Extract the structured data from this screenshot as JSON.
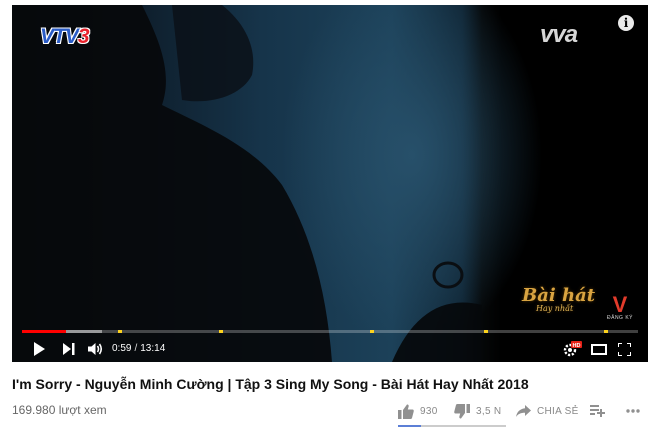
{
  "player": {
    "channel_logo": {
      "v": "VTV",
      "n": "3"
    },
    "brand_logo": "vva",
    "info_icon": "i",
    "show_logo": {
      "main": "Bài hát",
      "sub": "Hay nhất"
    },
    "subscribe_watermark": {
      "mark": "V",
      "label": "ĐĂNG KÝ"
    },
    "progress": {
      "played_fraction": 0.072,
      "buffered_fraction": 0.13,
      "ad_markers": [
        0.156,
        0.32,
        0.565,
        0.75,
        0.945
      ]
    },
    "time": {
      "current": "0:59",
      "separator": "/",
      "duration": "13:14"
    },
    "icons": [
      "play-icon",
      "next-icon",
      "volume-icon",
      "settings-hd-icon",
      "theater-icon",
      "fullscreen-icon"
    ],
    "hd_badge": "HD",
    "colors": {
      "progress": "#ff0000",
      "ad_marker": "#fcd21e",
      "hd_badge": "#e62117"
    }
  },
  "video": {
    "title": "I'm Sorry - Nguyễn Minh Cường | Tập 3 Sing My Song - Bài Hát Hay Nhất 2018",
    "views": "169.980 lượt xem"
  },
  "actions": {
    "like_count": "930",
    "dislike_count": "3,5 N",
    "share_label": "CHIA SẺ",
    "like_fraction": 0.21
  }
}
